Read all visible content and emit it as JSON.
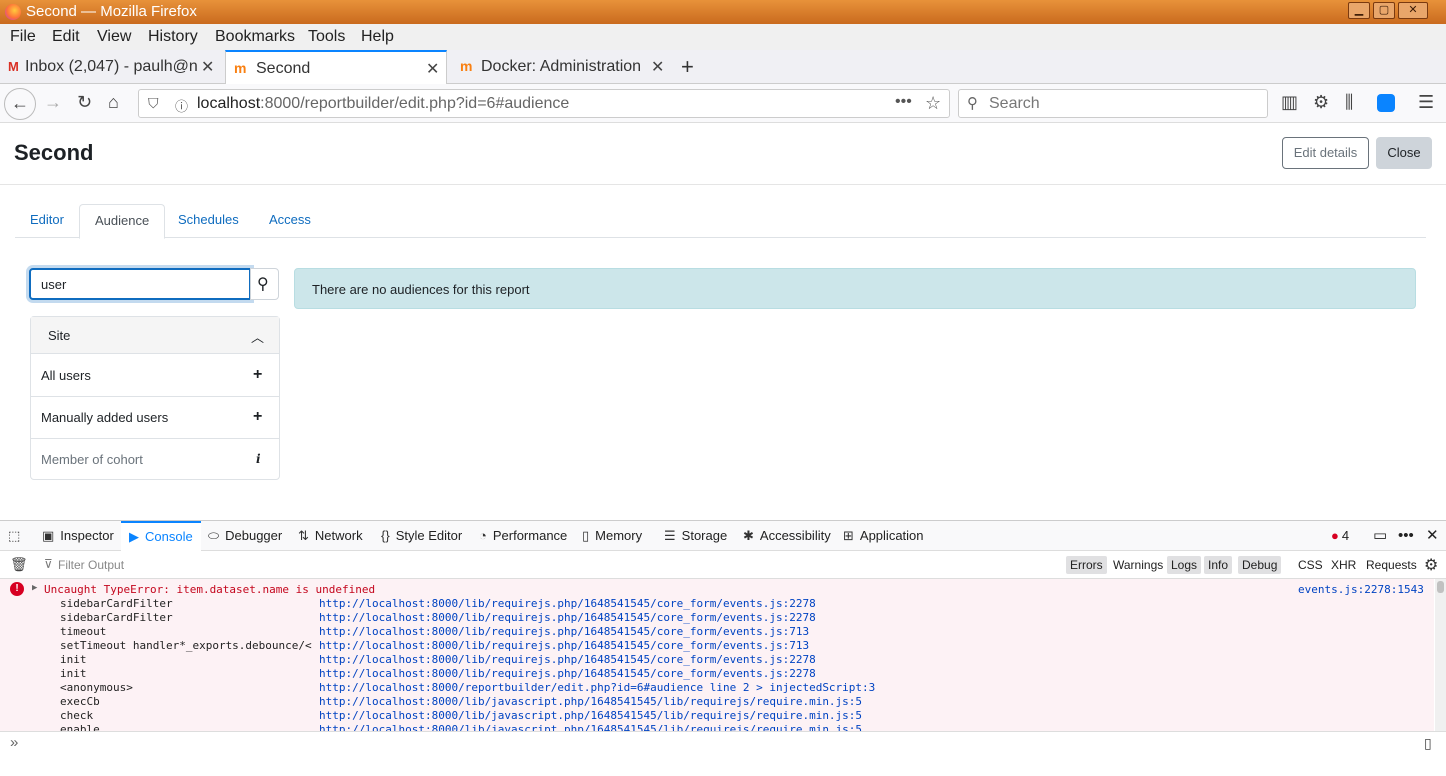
{
  "window": {
    "title": "Second — Mozilla Firefox",
    "controls": [
      "▁",
      "▢",
      "✕"
    ]
  },
  "menubar": [
    "File",
    "Edit",
    "View",
    "History",
    "Bookmarks",
    "Tools",
    "Help"
  ],
  "browser_tabs": [
    {
      "label": "Inbox (2,047) - paulh@n",
      "icon": "gmail-icon",
      "active": false
    },
    {
      "label": "Second",
      "icon": "moodle-icon",
      "active": true
    },
    {
      "label": "Docker: Administration: ",
      "icon": "moodle-icon",
      "active": false
    }
  ],
  "new_tab_symbol": "+",
  "url": {
    "host": "localhost",
    "path": ":8000/reportbuilder/edit.php?id=6#audience"
  },
  "search_placeholder": "Search",
  "page": {
    "title": "Second",
    "edit_details_label": "Edit details",
    "close_label": "Close",
    "tabs": [
      "Editor",
      "Audience",
      "Schedules",
      "Access"
    ],
    "active_tab": "Audience",
    "search_value": "user",
    "card": {
      "header": "Site",
      "items": [
        {
          "label": "All users",
          "icon": "plus-icon"
        },
        {
          "label": "Manually added users",
          "icon": "plus-icon"
        },
        {
          "label": "Member of cohort",
          "icon": "info-icon"
        }
      ]
    },
    "alert_text": "There are no audiences for this report"
  },
  "devtools": {
    "tools": [
      "Inspector",
      "Console",
      "Debugger",
      "Network",
      "Style Editor",
      "Performance",
      "Memory",
      "Storage",
      "Accessibility",
      "Application"
    ],
    "active_tool": "Console",
    "error_count": "4",
    "filter_placeholder": "Filter Output",
    "levels": [
      "Errors",
      "Warnings",
      "Logs",
      "Info",
      "Debug"
    ],
    "types": [
      "CSS",
      "XHR",
      "Requests"
    ],
    "error": {
      "message": "Uncaught TypeError: item.dataset.name is undefined",
      "location": "events.js:2278:1543",
      "stack": [
        {
          "fn": "sidebarCardFilter",
          "src": "http://localhost:8000/lib/requirejs.php/1648541545/core_form/events.js:2278"
        },
        {
          "fn": "sidebarCardFilter",
          "src": "http://localhost:8000/lib/requirejs.php/1648541545/core_form/events.js:2278"
        },
        {
          "fn": "timeout",
          "src": "http://localhost:8000/lib/requirejs.php/1648541545/core_form/events.js:713"
        },
        {
          "fn": "setTimeout handler*_exports.debounce/<",
          "src": "http://localhost:8000/lib/requirejs.php/1648541545/core_form/events.js:713"
        },
        {
          "fn": "init",
          "src": "http://localhost:8000/lib/requirejs.php/1648541545/core_form/events.js:2278"
        },
        {
          "fn": "init",
          "src": "http://localhost:8000/lib/requirejs.php/1648541545/core_form/events.js:2278"
        },
        {
          "fn": "<anonymous>",
          "src": "http://localhost:8000/reportbuilder/edit.php?id=6#audience line 2 > injectedScript:3"
        },
        {
          "fn": "execCb",
          "src": "http://localhost:8000/lib/javascript.php/1648541545/lib/requirejs/require.min.js:5"
        },
        {
          "fn": "check",
          "src": "http://localhost:8000/lib/javascript.php/1648541545/lib/requirejs/require.min.js:5"
        },
        {
          "fn": "enable",
          "src": "http://localhost:8000/lib/javascript.php/1648541545/lib/requirejs/require.min.js:5"
        }
      ]
    },
    "prompt_symbol": "»"
  }
}
